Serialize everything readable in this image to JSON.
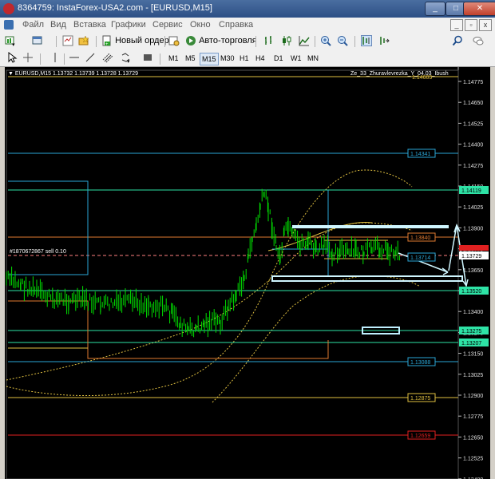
{
  "window": {
    "title": "8364759: InstaForex-USA2.com - [EURUSD,M15]",
    "buttons": {
      "minimize": "_",
      "maximize": "□",
      "close": "✕"
    }
  },
  "menu": {
    "items": [
      "Файл",
      "Вид",
      "Вставка",
      "Графики",
      "Сервис",
      "Окно",
      "Справка"
    ],
    "mdi": {
      "minimize": "_",
      "restore": "▫",
      "close": "x"
    }
  },
  "toolbar": {
    "new_order": "Новый ордер",
    "autotrade": "Авто-торговля"
  },
  "timeframes": {
    "items": [
      "M1",
      "M5",
      "M15",
      "M30",
      "H1",
      "H4",
      "D1",
      "W1",
      "MN"
    ],
    "active": "M15"
  },
  "chart": {
    "header": "▼ EURUSD,M15  1.13732 1.13739 1.13728 1.13729",
    "indicator_label": "Ze_33_Zhuravlevrezka_Y_04.03_Ibush",
    "order_label": "#1870672867 sell 0.10",
    "ticks": [
      "1.14775",
      "1.14650",
      "1.14525",
      "1.14400",
      "1.14275",
      "1.14150",
      "1.14025",
      "1.13900",
      "1.13775",
      "1.13650",
      "1.13525",
      "1.13400",
      "1.13275",
      "1.13150",
      "1.13025",
      "1.12900",
      "1.12775",
      "1.12650",
      "1.12525",
      "1.12400"
    ],
    "level_labels": {
      "l14605": "1.14605",
      "l14341": "1.14341",
      "l14119": "1.14119",
      "l13840": "1.13840",
      "l13714": "1.13714",
      "l13729": "1.13729",
      "l13520": "1.13520",
      "l13275": "1.13275",
      "l13207": "1.13207",
      "l13088": "1.13088",
      "l12875": "1.12875",
      "l12659": "1.12659"
    },
    "colors": {
      "background": "#000000",
      "candles": "#00e000",
      "levels_aqua": "#2ee3a6",
      "levels_blue": "#2aa6d6",
      "level_orange": "#e07a30",
      "level_yellow": "#e0c040",
      "level_red": "#e02020",
      "ma_yellow": "#e0c040"
    }
  }
}
